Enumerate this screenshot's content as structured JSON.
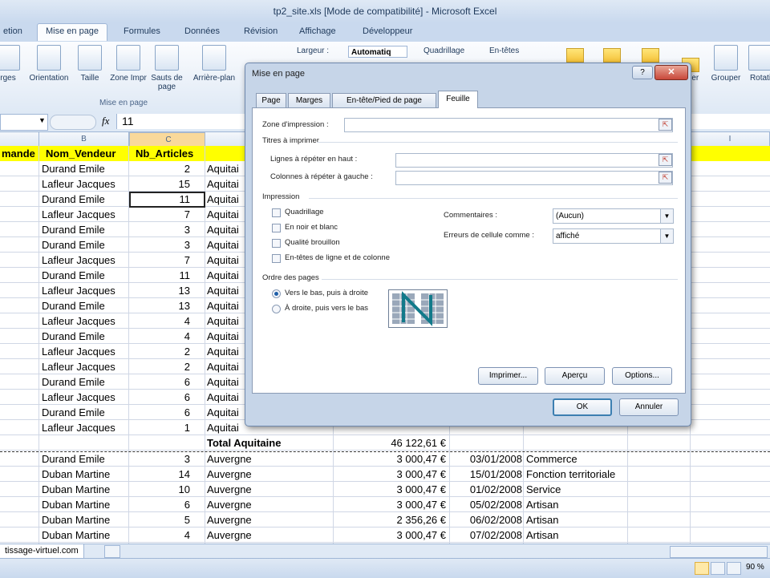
{
  "window": {
    "title": "tp2_site.xls [Mode de compatibilité] - Microsoft Excel"
  },
  "ribbon_tabs": [
    "etion",
    "Mise en page",
    "Formules",
    "Données",
    "Révision",
    "Affichage",
    "Développeur"
  ],
  "ribbon": {
    "buttons": [
      "rges",
      "Orientation",
      "Taille",
      "Zone Impr",
      "Sauts de page",
      "Arrière-plan"
    ],
    "group_label": "Mise en page",
    "largeur_label": "Largeur :",
    "largeur_value": "Automatiq",
    "quadrillage": "Quadrillage",
    "entetes": "En-têtes",
    "right_buttons": [
      "her",
      "Grouper",
      "Rotati"
    ]
  },
  "formula_bar": {
    "fx": "fx",
    "value": "11"
  },
  "column_headers": [
    "B",
    "C",
    "F",
    "G",
    "H",
    "I"
  ],
  "sheet": {
    "header": [
      "mande",
      "Nom_Vendeur",
      "Nb_Articles"
    ],
    "rows": [
      {
        "vendeur": "Durand Emile",
        "nb": "2",
        "region": "Aquitai"
      },
      {
        "vendeur": "Lafleur Jacques",
        "nb": "15",
        "region": "Aquitai"
      },
      {
        "vendeur": "Durand Emile",
        "nb": "11",
        "region": "Aquitai"
      },
      {
        "vendeur": "Lafleur Jacques",
        "nb": "7",
        "region": "Aquitai"
      },
      {
        "vendeur": "Durand Emile",
        "nb": "3",
        "region": "Aquitai"
      },
      {
        "vendeur": "Durand Emile",
        "nb": "3",
        "region": "Aquitai"
      },
      {
        "vendeur": "Lafleur Jacques",
        "nb": "7",
        "region": "Aquitai"
      },
      {
        "vendeur": "Durand Emile",
        "nb": "11",
        "region": "Aquitai"
      },
      {
        "vendeur": "Lafleur Jacques",
        "nb": "13",
        "region": "Aquitai"
      },
      {
        "vendeur": "Durand Emile",
        "nb": "13",
        "region": "Aquitai"
      },
      {
        "vendeur": "Lafleur Jacques",
        "nb": "4",
        "region": "Aquitai"
      },
      {
        "vendeur": "Durand Emile",
        "nb": "4",
        "region": "Aquitai"
      },
      {
        "vendeur": "Lafleur Jacques",
        "nb": "2",
        "region": "Aquitai"
      },
      {
        "vendeur": "Lafleur Jacques",
        "nb": "2",
        "region": "Aquitai"
      },
      {
        "vendeur": "Durand Emile",
        "nb": "6",
        "region": "Aquitai"
      },
      {
        "vendeur": "Lafleur Jacques",
        "nb": "6",
        "region": "Aquitai"
      },
      {
        "vendeur": "Durand Emile",
        "nb": "6",
        "region": "Aquitai"
      },
      {
        "vendeur": "Lafleur Jacques",
        "nb": "1",
        "region": "Aquitai"
      }
    ],
    "total": {
      "label": "Total Aquitaine",
      "amount": "46 122,61 €"
    },
    "rows2": [
      {
        "vendeur": "Durand Emile",
        "nb": "3",
        "region": "Auvergne",
        "montant": "3 000,47 €",
        "date": "03/01/2008",
        "type": "Commerce"
      },
      {
        "vendeur": "Duban Martine",
        "nb": "14",
        "region": "Auvergne",
        "montant": "3 000,47 €",
        "date": "15/01/2008",
        "type": "Fonction territoriale"
      },
      {
        "vendeur": "Duban Martine",
        "nb": "10",
        "region": "Auvergne",
        "montant": "3 000,47 €",
        "date": "01/02/2008",
        "type": "Service"
      },
      {
        "vendeur": "Duban Martine",
        "nb": "6",
        "region": "Auvergne",
        "montant": "3 000,47 €",
        "date": "05/02/2008",
        "type": "Artisan"
      },
      {
        "vendeur": "Duban Martine",
        "nb": "5",
        "region": "Auvergne",
        "montant": "2 356,26 €",
        "date": "06/02/2008",
        "type": "Artisan"
      },
      {
        "vendeur": "Duban Martine",
        "nb": "4",
        "region": "Auvergne",
        "montant": "3 000,47 €",
        "date": "07/02/2008",
        "type": "Artisan"
      }
    ]
  },
  "sheet_tab": "tissage-virtuel.com",
  "status": {
    "zoom": "90 %"
  },
  "dialog": {
    "title": "Mise en page",
    "tabs": [
      "Page",
      "Marges",
      "En-tête/Pied de page",
      "Feuille"
    ],
    "zone_impression": "Zone d'impression :",
    "titres": "Titres à imprimer",
    "lignes": "Lignes à répéter en haut :",
    "colonnes": "Colonnes à répéter à gauche :",
    "impression": "Impression",
    "checks": [
      "Quadrillage",
      "En noir et blanc",
      "Qualité brouillon",
      "En-têtes de ligne et de colonne"
    ],
    "commentaires_label": "Commentaires :",
    "commentaires_value": "(Aucun)",
    "erreurs_label": "Erreurs de cellule comme :",
    "erreurs_value": "affiché",
    "ordre": "Ordre des pages",
    "radio1": "Vers le bas, puis à droite",
    "radio2": "À droite, puis vers le bas",
    "btn_imprimer": "Imprimer...",
    "btn_apercu": "Aperçu",
    "btn_options": "Options...",
    "btn_ok": "OK",
    "btn_annuler": "Annuler"
  }
}
